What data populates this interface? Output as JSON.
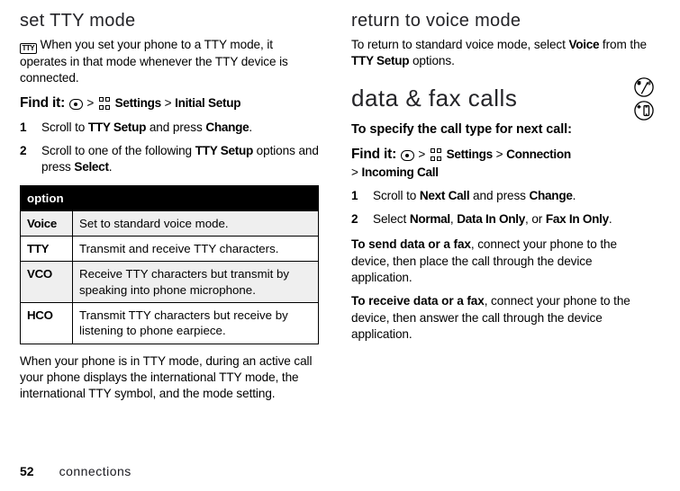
{
  "left": {
    "heading": "set TTY mode",
    "tty_icon_label": "TTY",
    "intro": "When you set your phone to a TTY mode, it operates in that mode whenever the TTY device is connected.",
    "findit_label": "Find it:",
    "path_settings": "Settings",
    "path_initial": "Initial Setup",
    "step1_a": "Scroll to ",
    "step1_b": "TTY Setup",
    "step1_c": " and press ",
    "step1_d": "Change",
    "step1_e": ".",
    "step2_a": "Scroll to one of the following ",
    "step2_b": "TTY Setup",
    "step2_c": " options and press ",
    "step2_d": "Select",
    "step2_e": ".",
    "table": {
      "header": "option",
      "rows": [
        {
          "key": "Voice",
          "val": "Set to standard voice mode."
        },
        {
          "key": "TTY",
          "val": "Transmit and receive TTY characters."
        },
        {
          "key": "VCO",
          "val": "Receive TTY characters but transmit by speaking into phone microphone."
        },
        {
          "key": "HCO",
          "val": "Transmit TTY characters but receive by listening to phone earpiece."
        }
      ]
    },
    "outro": "When your phone is in TTY mode, during an active call your phone displays the international TTY mode, the international TTY symbol, and the mode setting."
  },
  "right": {
    "heading1": "return to voice mode",
    "p1_a": "To return to standard voice mode, select ",
    "p1_b": "Voice",
    "p1_c": " from the ",
    "p1_d": "TTY Setup",
    "p1_e": " options.",
    "heading2": "data & fax calls",
    "specify": "To specify the call type for next call:",
    "findit_label": "Find it:",
    "path_settings": "Settings",
    "path_conn": "Connection",
    "path_incoming": "Incoming Call",
    "step1_a": "Scroll to ",
    "step1_b": "Next Call",
    "step1_c": " and press ",
    "step1_d": "Change",
    "step1_e": ".",
    "step2_a": "Select ",
    "step2_b": "Normal",
    "step2_c": ", ",
    "step2_d": "Data In Only",
    "step2_e": ", or ",
    "step2_f": "Fax In Only",
    "step2_g": ".",
    "send_a": "To send data or a fax",
    "send_b": ", connect your phone to the device, then place the call through the device application.",
    "recv_a": "To receive data or a fax",
    "recv_b": ", connect your phone to the device, then answer the call through the device application."
  },
  "footer": {
    "page": "52",
    "section": "connections"
  },
  "gt": ">"
}
